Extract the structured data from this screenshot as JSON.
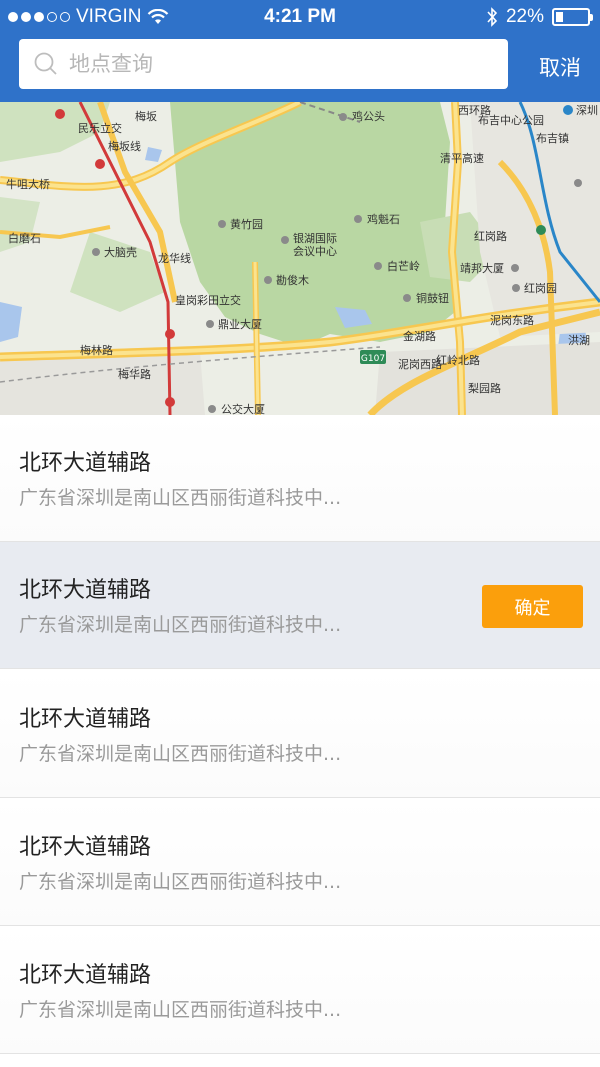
{
  "status_bar": {
    "carrier": "VIRGIN",
    "time": "4:21 PM",
    "battery_percent": "22%",
    "battery_level": 0.22,
    "signal_icons": [
      "signal-dots-icon",
      "wifi-icon",
      "bluetooth-icon",
      "battery-icon"
    ]
  },
  "search": {
    "placeholder": "地点查询",
    "value": "",
    "cancel_label": "取消"
  },
  "map": {
    "labels": {
      "l1": "民乐立交",
      "l2": "梅坂",
      "l3": "鸡公头",
      "l4": "布吉中心公园",
      "l5": "布吉镇",
      "l6": "牛咀大桥",
      "l7": "黄竹园",
      "l8": "鸡魁石",
      "l9": "白磨石",
      "l10": "大脑壳",
      "l11": "银湖国际",
      "l12": "会议中心",
      "l13": "白芒岭",
      "l14": "靖邦大厦",
      "l15": "勘俊木",
      "l16": "红岗园",
      "l17": "皇岗彩田立交",
      "l18": "铜鼓钮",
      "l19": "鼎业大厦",
      "l20": "金湖路",
      "l21": "梅林路",
      "l22": "梅华路",
      "l23": "泥岗西路",
      "l24": "泥岗东路",
      "l25": "公交大厦",
      "l26": "红岭北路",
      "l27": "清平高速",
      "l28": "西环路",
      "l29": "梨园路",
      "l30": "红岗路",
      "l31": "龙华线",
      "l32": "梅坂线",
      "l33": "洪湖",
      "l34": "深圳"
    },
    "highway_badge": "G107"
  },
  "results": [
    {
      "title": "北环大道辅路",
      "subtitle": "广东省深圳是南山区西丽街道科技中...",
      "selected": false
    },
    {
      "title": "北环大道辅路",
      "subtitle": "广东省深圳是南山区西丽街道科技中...",
      "selected": true,
      "confirm_label": "确定"
    },
    {
      "title": "北环大道辅路",
      "subtitle": "广东省深圳是南山区西丽街道科技中...",
      "selected": false
    },
    {
      "title": "北环大道辅路",
      "subtitle": "广东省深圳是南山区西丽街道科技中...",
      "selected": false
    },
    {
      "title": "北环大道辅路",
      "subtitle": "广东省深圳是南山区西丽街道科技中...",
      "selected": false
    }
  ],
  "colors": {
    "header": "#2f72c9",
    "confirm_button": "#fb9f0c",
    "selected_row": "#e8ebf1"
  }
}
